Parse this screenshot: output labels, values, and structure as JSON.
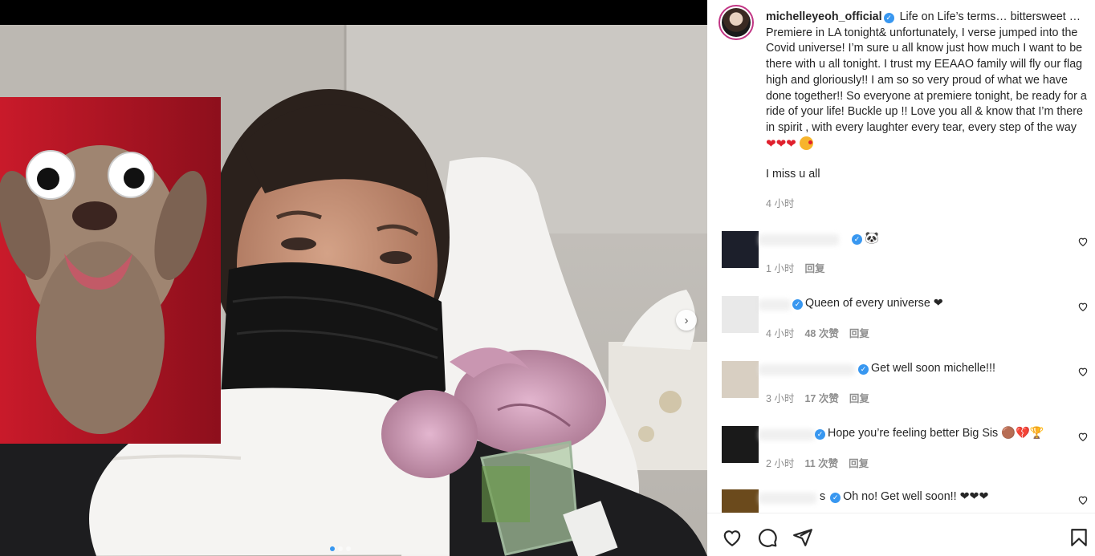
{
  "post": {
    "author": "michelleyeoh_official",
    "caption": "Life on Life’s terms… bittersweet …Premiere in LA tonight& unfortunately, I verse jumped into the Covid universe! I’m sure u all know just how much I want to be there with u all tonight. I trust my EEAAO family will fly our flag high and gloriously!! I am so so very proud of what we have done together!! So everyone at premiere tonight, be ready for a ride of your life! Buckle up !! Love you all & know that I’m there in spirit , with every laughter every tear, every step of the way",
    "caption_emojis": "❤❤❤",
    "caption_last_line": "I miss u all",
    "time": "4 小时"
  },
  "comments": [
    {
      "text": "🐼",
      "time": "1 小时",
      "likes": "",
      "reply": "回复",
      "avatar_color": "#1c1f2b"
    },
    {
      "text": "Queen of every universe ❤",
      "time": "4 小时",
      "likes": "48 次赞",
      "reply": "回复",
      "avatar_color": "#e9e9e9"
    },
    {
      "text": "Get well soon michelle!!!",
      "time": "3 小时",
      "likes": "17 次赞",
      "reply": "回复",
      "avatar_color": "#d8cfc2"
    },
    {
      "text": "Hope you’re feeling better Big Sis 🟤💔🏆",
      "time": "2 小时",
      "likes": "11 次赞",
      "reply": "回复",
      "avatar_color": "#1a1a1a"
    },
    {
      "text": "Oh no! Get well soon!! ❤❤❤",
      "time": "",
      "likes": "",
      "reply": "",
      "avatar_color": "#6b4a1c"
    }
  ],
  "comment_name_fragments": [
    "",
    "",
    "",
    "",
    "s"
  ],
  "photo": {
    "next_arrow": "›",
    "dots_count": 3
  },
  "colors": {
    "accent": "#3897f0",
    "heart": "#e0202d",
    "muted": "#8e8e8e"
  },
  "actions": [
    "heart-icon",
    "comment-icon",
    "share-icon",
    "bookmark-icon"
  ]
}
